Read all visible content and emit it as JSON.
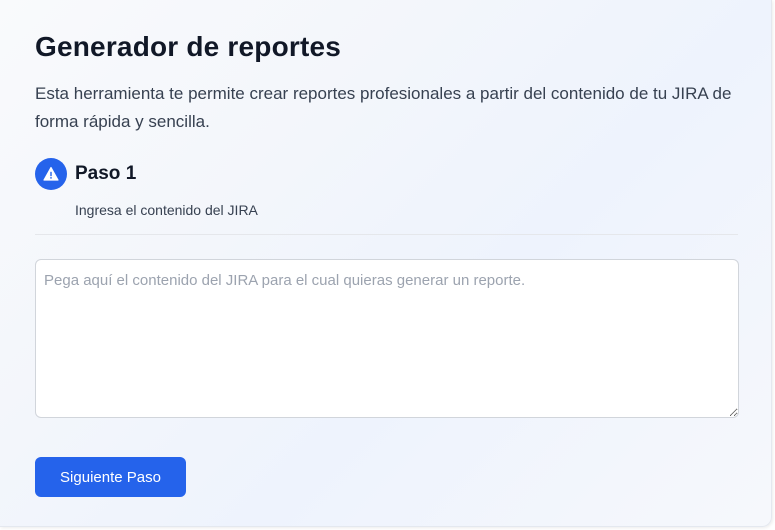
{
  "header": {
    "title": "Generador de reportes",
    "description": "Esta herramienta te permite crear reportes profesionales a partir del contenido de tu JIRA de forma rápida y sencilla."
  },
  "step": {
    "icon": "warning-triangle-icon",
    "title": "Paso 1",
    "subtitle": "Ingresa el contenido del JIRA"
  },
  "input": {
    "value": "",
    "placeholder": "Pega aquí el contenido del JIRA para el cual quieras generar un reporte."
  },
  "actions": {
    "next_label": "Siguiente Paso"
  },
  "colors": {
    "accent": "#2563eb",
    "title": "#111827",
    "text": "#374151",
    "placeholder": "#9ca3af"
  }
}
